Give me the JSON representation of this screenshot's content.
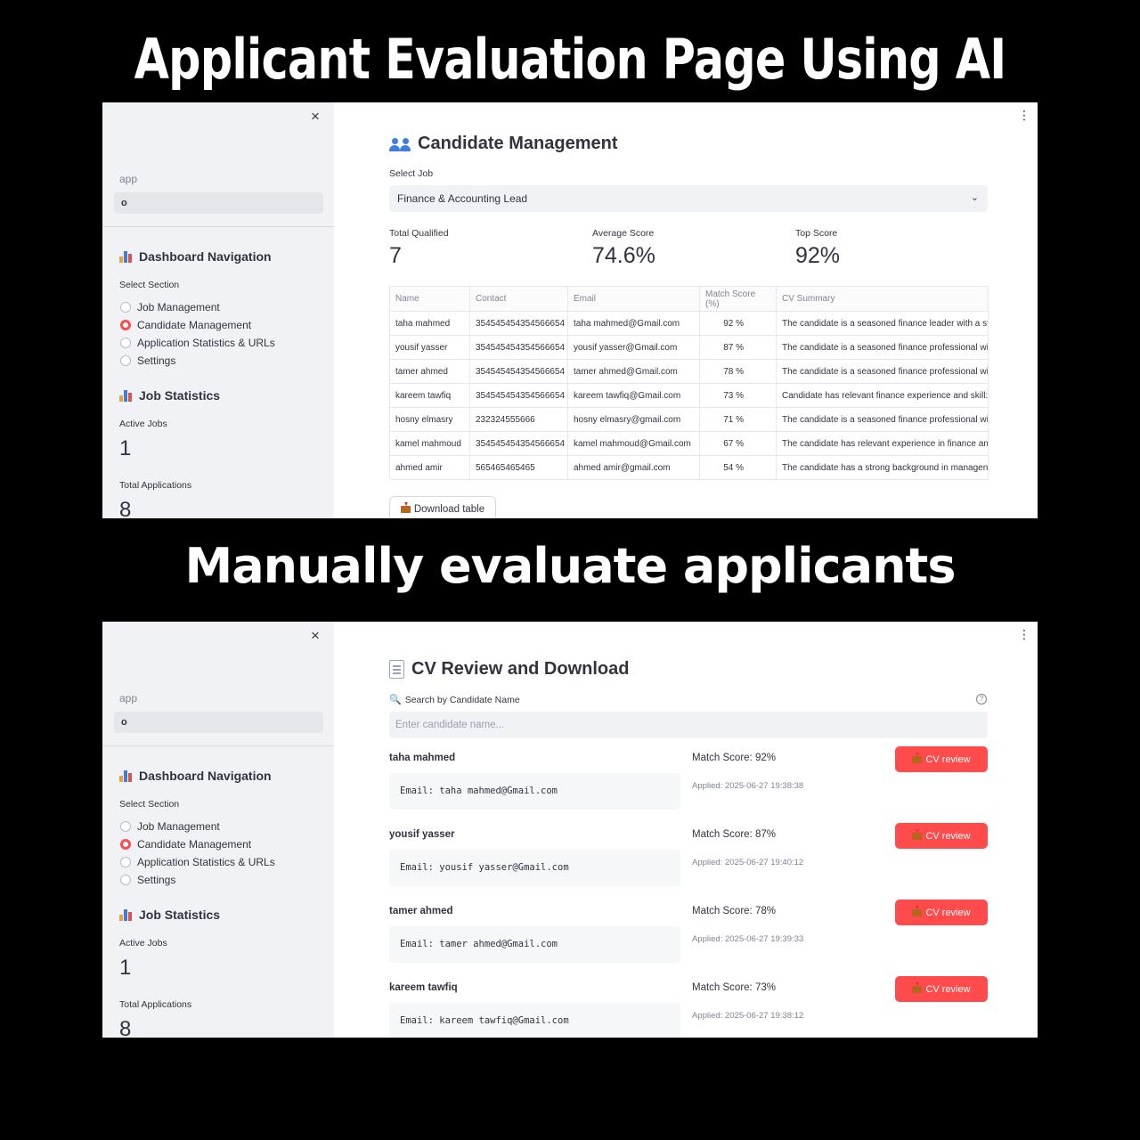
{
  "headline_1": "Applicant Evaluation Page Using AI",
  "headline_2": "Manually evaluate applicants",
  "sidebar": {
    "close": "×",
    "app_label": "app",
    "app_value": "o",
    "nav_heading": "Dashboard Navigation",
    "select_section": "Select Section",
    "sections": [
      "Job Management",
      "Candidate Management",
      "Application Statistics & URLs",
      "Settings"
    ],
    "selected_section": "Candidate Management",
    "stats_heading": "Job Statistics",
    "active_jobs_label": "Active Jobs",
    "active_jobs": "1",
    "total_apps_label": "Total Applications",
    "total_apps": "8"
  },
  "candidate_mgmt": {
    "title": "Candidate Management",
    "select_job_label": "Select Job",
    "selected_job": "Finance & Accounting Lead",
    "metrics": {
      "total_qualified_label": "Total Qualified",
      "total_qualified": "7",
      "avg_score_label": "Average Score",
      "avg_score": "74.6%",
      "top_score_label": "Top Score",
      "top_score": "92%"
    },
    "columns": [
      "Name",
      "Contact",
      "Email",
      "Match Score (%)",
      "CV Summary"
    ],
    "rows": [
      [
        "taha mahmed",
        "354545454354566654",
        "taha mahmed@Gmail.com",
        "92 %",
        "The candidate is a seasoned finance leader with a st"
      ],
      [
        "yousif yasser",
        "354545454354566654",
        "yousif yasser@Gmail.com",
        "87 %",
        "The candidate is a seasoned finance professional wi"
      ],
      [
        "tamer ahmed",
        "354545454354566654",
        "tamer ahmed@Gmail.com",
        "78 %",
        "The candidate is a seasoned finance professional wi"
      ],
      [
        "kareem tawfiq",
        "354545454354566654",
        "kareem tawfiq@Gmail.com",
        "73 %",
        "Candidate has relevant finance experience and skill:"
      ],
      [
        "hosny elmasry",
        "232324555666",
        "hosny elmasry@gmail.com",
        "71 %",
        "The candidate is a seasoned finance professional wi"
      ],
      [
        "kamel mahmoud",
        "354545454354566654",
        "kamel mahmoud@Gmail.com",
        "67 %",
        "The candidate has relevant experience in finance an"
      ],
      [
        "ahmed amir",
        "565465465465",
        "ahmed amir@gmail.com",
        "54 %",
        "The candidate has a strong background in managen"
      ]
    ],
    "download_label": "Download table"
  },
  "cv_review": {
    "title": "CV Review and Download",
    "search_label": "Search by Candidate Name",
    "search_placeholder": "Enter candidate name...",
    "button_label": "CV review",
    "candidates": [
      {
        "name": "taha mahmed",
        "email": "Email: taha mahmed@Gmail.com",
        "score": "Match Score: 92%",
        "applied": "Applied: 2025-06-27 19:38:38"
      },
      {
        "name": "yousif yasser",
        "email": "Email: yousif yasser@Gmail.com",
        "score": "Match Score: 87%",
        "applied": "Applied: 2025-06-27 19:40:12"
      },
      {
        "name": "tamer ahmed",
        "email": "Email: tamer ahmed@Gmail.com",
        "score": "Match Score: 78%",
        "applied": "Applied: 2025-06-27 19:39:33"
      },
      {
        "name": "kareem tawfiq",
        "email": "Email: kareem tawfiq@Gmail.com",
        "score": "Match Score: 73%",
        "applied": "Applied: 2025-06-27 19:38:12"
      }
    ]
  }
}
